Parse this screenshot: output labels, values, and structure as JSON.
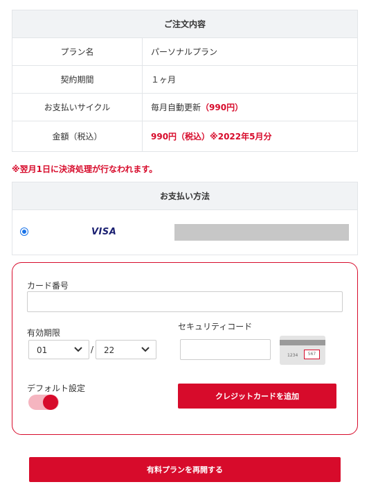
{
  "order": {
    "header": "ご注文内容",
    "rows": [
      {
        "label": "プラン名",
        "value": "パーソナルプラン"
      },
      {
        "label": "契約期間",
        "value": "１ヶ月"
      },
      {
        "label": "お支払いサイクル",
        "value": "毎月自動更新",
        "value_accent": "（990円）"
      },
      {
        "label": "金額（税込）",
        "value_accent": "990円（税込）※2022年5月分"
      }
    ]
  },
  "notice": "※翌月1日に決済処理が行なわれます。",
  "payment": {
    "header": "お支払い方法",
    "selected_brand": "VISA"
  },
  "card_form": {
    "card_number_label": "カード番号",
    "card_number_value": "",
    "expiry_label": "有効期限",
    "expiry_month": "01",
    "expiry_separator": "/",
    "expiry_year": "22",
    "security_code_label": "セキュリティコード",
    "security_code_value": "",
    "cvv_sample_number": "1234",
    "cvv_sample_code": "567",
    "default_label": "デフォルト設定",
    "default_on": true,
    "add_card_button": "クレジットカードを追加"
  },
  "resume_button": "有料プランを再開する",
  "colors": {
    "accent": "#d70b2b",
    "toggle_track": "#f5b5c0",
    "header_bg": "#f1f3f5",
    "masked_card": "#c7c7c7"
  }
}
